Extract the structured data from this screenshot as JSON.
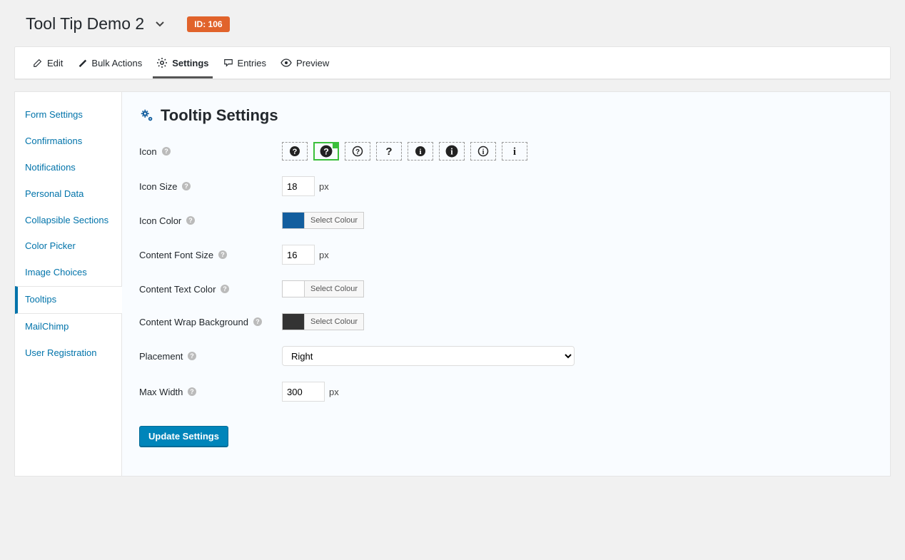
{
  "header": {
    "title": "Tool Tip Demo 2",
    "id_label": "ID: 106"
  },
  "tabs": {
    "edit": "Edit",
    "bulk": "Bulk Actions",
    "settings": "Settings",
    "entries": "Entries",
    "preview": "Preview"
  },
  "sidebar": {
    "items": [
      "Form Settings",
      "Confirmations",
      "Notifications",
      "Personal Data",
      "Collapsible Sections",
      "Color Picker",
      "Image Choices",
      "Tooltips",
      "MailChimp",
      "User Registration"
    ]
  },
  "main": {
    "title": "Tooltip Settings",
    "labels": {
      "icon": "Icon",
      "icon_size": "Icon Size",
      "icon_color": "Icon Color",
      "content_font_size": "Content Font Size",
      "content_text_color": "Content Text Color",
      "content_wrap_bg": "Content Wrap Background",
      "placement": "Placement",
      "max_width": "Max Width"
    },
    "values": {
      "icon_size": "18",
      "content_font_size": "16",
      "max_width": "300",
      "placement": "Right",
      "icon_color": "#135e9e",
      "content_text_color": "#ffffff",
      "content_wrap_bg": "#333333"
    },
    "px_suffix": "px",
    "select_colour": "Select Colour",
    "update_btn": "Update Settings",
    "icon_choices": [
      "question-circle-solid",
      "question-circle-solid-bold",
      "question-circle-outline",
      "question-mark",
      "info-circle-solid",
      "info-circle-solid-bold",
      "info-circle-outline",
      "info-serif"
    ],
    "selected_icon_index": 1
  }
}
